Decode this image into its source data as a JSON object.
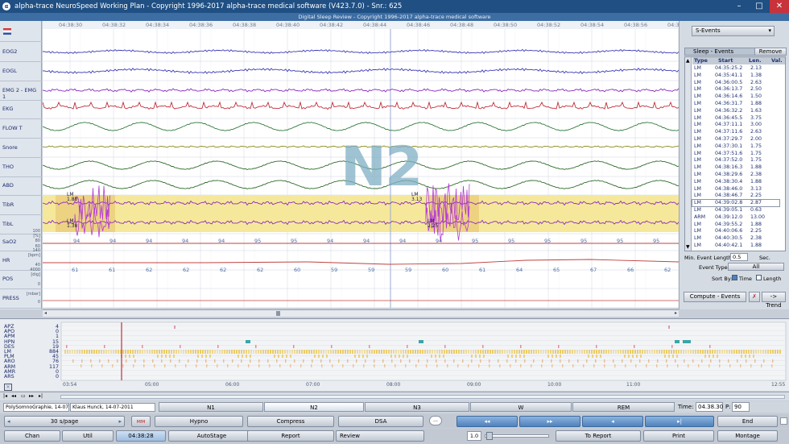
{
  "window": {
    "title": "alpha-trace NeuroSpeed Working Plan - Copyright 1996-2017 alpha-trace medical software (V423.7.0) - Snr.: 625",
    "subtitle": "Digital Sleep Review - Copyright 1996-2017 alpha-trace medical software",
    "minimize": "–",
    "maximize": "□",
    "close": "✕"
  },
  "time_ticks": [
    "04:38:30",
    "04:38:32",
    "04:38:34",
    "04:38:36",
    "04:38:38",
    "04:38:40",
    "04:38:42",
    "04:38:44",
    "04:38:46",
    "04:38:48",
    "04:38:50",
    "04:38:52",
    "04:38:54",
    "04:38:56",
    "04:38:58"
  ],
  "channels": [
    {
      "name": "EOG2"
    },
    {
      "name": "EOGL"
    },
    {
      "name": "EMG 2 - EMG 1"
    },
    {
      "name": "EKG"
    },
    {
      "name": "FLOW T"
    },
    {
      "name": "Snore"
    },
    {
      "name": "THO"
    },
    {
      "name": "ABD"
    },
    {
      "name": "TibR"
    },
    {
      "name": "TibL"
    },
    {
      "name": "SaO2"
    },
    {
      "name": "HR"
    },
    {
      "name": "POS"
    },
    {
      "name": "PRESS"
    }
  ],
  "scale_labels": {
    "sao2_top": "100",
    "sao2_unit": "[%]",
    "sao2_mid": "80",
    "sao2_bot": "60",
    "hr_top": "140",
    "hr_unit": "[bpm]",
    "hr_bot": "40",
    "pos_top": "4000",
    "pos_unit": "[dig]",
    "pos_bot": "0",
    "press_unit": "[mbar]",
    "press_bot": "0"
  },
  "stage_overlay": "N2",
  "lm_markers": [
    {
      "label": "LM",
      "value": "1.88"
    },
    {
      "label": "LM",
      "value": "1.38"
    },
    {
      "label": "LM",
      "value": "3.13"
    },
    {
      "label": "LM",
      "value": "2.25"
    }
  ],
  "sao2_values": [
    "94",
    "94",
    "94",
    "94",
    "94",
    "95",
    "95",
    "94",
    "94",
    "94",
    "94",
    "95",
    "95",
    "95",
    "95",
    "95",
    "95",
    "95",
    "95"
  ],
  "hr_values": [
    "61",
    "61",
    "62",
    "62",
    "62",
    "62",
    "60",
    "59",
    "59",
    "59",
    "60",
    "61",
    "64",
    "65",
    "67",
    "66",
    "62"
  ],
  "right_panel": {
    "dropdown": "S-Events",
    "table_title": "Sleep - Events",
    "remove_btn": "Remove",
    "headers": [
      "Type",
      "Start",
      "Len.",
      "Val."
    ],
    "rows": [
      [
        "LM",
        "04:35:25.2",
        "2.13",
        ""
      ],
      [
        "LM",
        "04:35:41.1",
        "1.38",
        ""
      ],
      [
        "LM",
        "04:36:00.5",
        "2.63",
        ""
      ],
      [
        "LM",
        "04:36:13.7",
        "2.50",
        ""
      ],
      [
        "LM",
        "04:36:14.6",
        "1.50",
        ""
      ],
      [
        "LM",
        "04:36:31.7",
        "1.88",
        ""
      ],
      [
        "LM",
        "04:36:32.2",
        "1.63",
        ""
      ],
      [
        "LM",
        "04:36:45.5",
        "3.75",
        ""
      ],
      [
        "LM",
        "04:37:11.1",
        "3.00",
        ""
      ],
      [
        "LM",
        "04:37:11.6",
        "2.63",
        ""
      ],
      [
        "LM",
        "04:37:29.7",
        "2.00",
        ""
      ],
      [
        "LM",
        "04:37:30.1",
        "1.75",
        ""
      ],
      [
        "LM",
        "04:37:51.6",
        "1.75",
        ""
      ],
      [
        "LM",
        "04:37:52.0",
        "1.75",
        ""
      ],
      [
        "LM",
        "04:38:16.3",
        "1.88",
        ""
      ],
      [
        "LM",
        "04:38:29.6",
        "2.38",
        ""
      ],
      [
        "LM",
        "04:38:30.4",
        "1.88",
        ""
      ],
      [
        "LM",
        "04:38:46.0",
        "3.13",
        ""
      ],
      [
        "LM",
        "04:38:46.7",
        "2.25",
        ""
      ],
      [
        "LM",
        "04:39:02.8",
        "2.87",
        ""
      ],
      [
        "LM",
        "04:39:05.1",
        "0.63",
        ""
      ],
      [
        "ARM",
        "04:39:12.0",
        "13.00",
        ""
      ],
      [
        "LM",
        "04:39:55.2",
        "1.88",
        ""
      ],
      [
        "LM",
        "04:40:06.6",
        "2.25",
        ""
      ],
      [
        "LM",
        "04:40:30.5",
        "2.38",
        ""
      ],
      [
        "LM",
        "04:40:42.1",
        "1.88",
        ""
      ]
    ],
    "min_event_length_label": "Min. Event Length:",
    "min_event_length_value": "0.5",
    "min_event_length_unit": "Sec.",
    "event_types_label": "Event Types:",
    "event_types_value": "All",
    "sort_by_label": "Sort By:",
    "sort_time": "Time",
    "sort_length": "Length",
    "compute_btn": "Compute - Events",
    "trend_btn": "-> Trend"
  },
  "overview": {
    "rows": [
      {
        "name": "APZ",
        "count": "4"
      },
      {
        "name": "APO",
        "count": "0"
      },
      {
        "name": "APM",
        "count": "1"
      },
      {
        "name": "HPN",
        "count": "15"
      },
      {
        "name": "DES",
        "count": "19"
      },
      {
        "name": "LM",
        "count": "884"
      },
      {
        "name": "PLM",
        "count": "45"
      },
      {
        "name": "ARO",
        "count": "76"
      },
      {
        "name": "ARM",
        "count": "117"
      },
      {
        "name": "AMR",
        "count": "0"
      },
      {
        "name": "ARS",
        "count": "0"
      }
    ],
    "time_ticks": [
      "03:54",
      "05:00",
      "06:00",
      "07:00",
      "08:00",
      "09:00",
      "10:00",
      "11:00",
      "12:55"
    ]
  },
  "stage_bar": {
    "patient": "PolySomnoGraphie, 14-07-",
    "person": "Klaus Hunck, 14-07-2011",
    "stages": [
      "N1",
      "N2",
      "N3",
      "W",
      "REM"
    ],
    "time_label": "Time:",
    "time_value": "04.38.30",
    "page_label": "P:",
    "page_value": "90"
  },
  "toolbar1": {
    "speed": "30 s/page",
    "hypno": "Hypno",
    "compress": "Compress",
    "dsa": "DSA",
    "nav": [
      "◂◂",
      "▸▸",
      "◂",
      "▸|"
    ],
    "end": "End"
  },
  "toolbar2": {
    "chan": "Chan",
    "util": "Util",
    "clock": "04:38:28",
    "autostage": "AutoStage",
    "report": "Report",
    "review": "Review",
    "zoom": "1.0",
    "to_report": "To Report",
    "print": "Print",
    "montage": "Montage"
  }
}
